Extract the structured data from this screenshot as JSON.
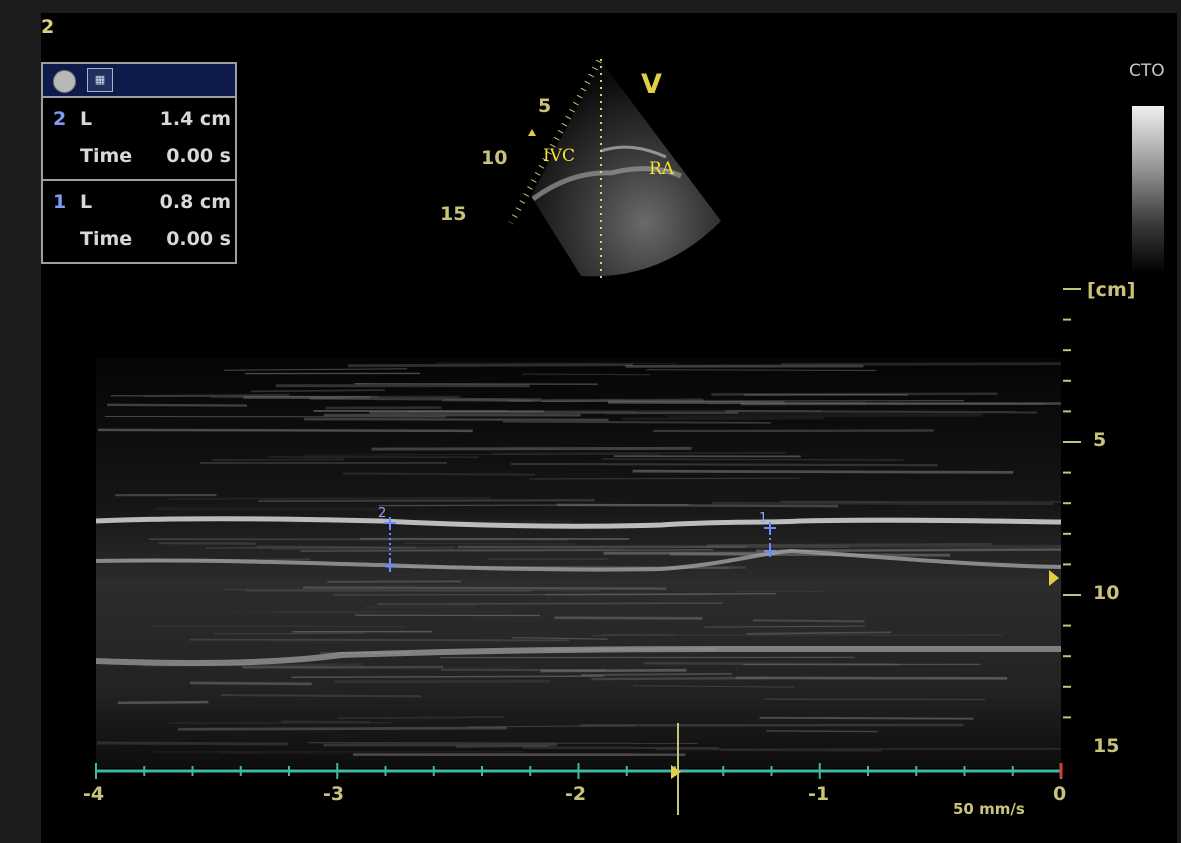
{
  "clip_number": "2",
  "measurements": [
    {
      "index": "2",
      "label": "L",
      "value": "1.4 cm",
      "time_label": "Time",
      "time_value": "0.00 s"
    },
    {
      "index": "1",
      "label": "L",
      "value": "0.8 cm",
      "time_label": "Time",
      "time_value": "0.00 s"
    }
  ],
  "sector": {
    "labels": {
      "ivc": "IVC",
      "ra": "RA",
      "orientation": "V"
    },
    "depth_ticks": [
      "5",
      "10",
      "15"
    ]
  },
  "grayscale": {
    "label": "CTO"
  },
  "mmode": {
    "depth_unit": "[cm]",
    "depth_labels": [
      "5",
      "10",
      "15"
    ],
    "time_labels": [
      "-4",
      "-3",
      "-2",
      "-1",
      "0"
    ],
    "sweep_speed": "50 mm/s",
    "calipers": [
      {
        "label": "2"
      },
      {
        "label": "1"
      }
    ]
  },
  "colors": {
    "caliper": "#6f8cff",
    "timeline": "#3fb7a6",
    "annotation": "#f2e23a",
    "scale_text": "#c9c27a"
  },
  "icons": [
    "record-icon",
    "measurement-icon",
    "depth-marker-icon",
    "focus-marker-icon",
    "cursor-marker-icon"
  ]
}
